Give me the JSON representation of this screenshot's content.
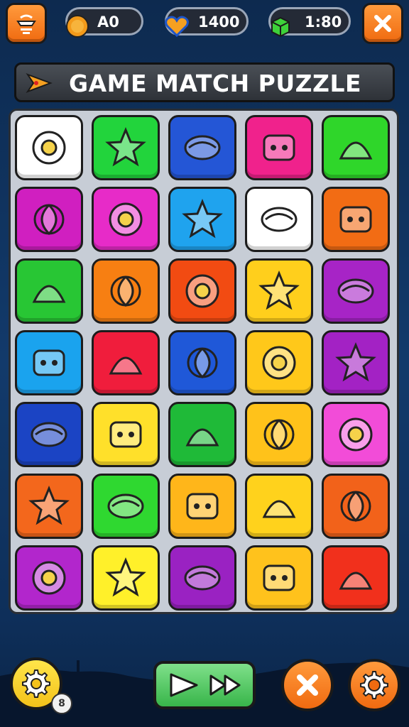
{
  "header": {
    "coins": {
      "value": "A0",
      "icon": "coin-icon"
    },
    "lives": {
      "value": "1400",
      "icon": "heart-icon"
    },
    "gems": {
      "value": "1:80",
      "icon": "cube-icon"
    }
  },
  "title": {
    "text": "GAME MATCH PUZZLE",
    "icon": "arrow-flag-icon"
  },
  "board": {
    "rows": 7,
    "cols": 5,
    "tiles": [
      {
        "icon": "flowers-icon",
        "color": "#ffffff"
      },
      {
        "icon": "star-face-icon",
        "color": "#22d43c"
      },
      {
        "icon": "leaf-swirl-icon",
        "color": "#2456d6"
      },
      {
        "icon": "fish-ball-icon",
        "color": "#f0228c"
      },
      {
        "icon": "spiral-icon",
        "color": "#2fd62a"
      },
      {
        "icon": "cloud-blob-icon",
        "color": "#d01fc0"
      },
      {
        "icon": "ring-fruit-icon",
        "color": "#e72bc8"
      },
      {
        "icon": "crayon-icon",
        "color": "#1fa3ee"
      },
      {
        "icon": "crossed-sticks-icon",
        "color": "#ffffff"
      },
      {
        "icon": "domino-icon",
        "color": "#f26c14"
      },
      {
        "icon": "swirl-bubble-icon",
        "color": "#28c634"
      },
      {
        "icon": "spiky-ball-icon",
        "color": "#f77f12"
      },
      {
        "icon": "bell-flower-icon",
        "color": "#f24b12"
      },
      {
        "icon": "red-sun-face-icon",
        "color": "#ffcf1c"
      },
      {
        "icon": "star-emoji-icon",
        "color": "#a724c6"
      },
      {
        "icon": "sunflower-icon",
        "color": "#1aa3ee"
      },
      {
        "icon": "blue-fruit-icon",
        "color": "#f01d3c"
      },
      {
        "icon": "pink-hook-icon",
        "color": "#1f58d8"
      },
      {
        "icon": "planet-ball-icon",
        "color": "#ffc81a"
      },
      {
        "icon": "pink-pretzel-icon",
        "color": "#a322c4"
      },
      {
        "icon": "red-leaf-icon",
        "color": "#1b44c4"
      },
      {
        "icon": "rainbow-swirl-icon",
        "color": "#ffe02a"
      },
      {
        "icon": "cookie-lollipop-icon",
        "color": "#1fba38"
      },
      {
        "icon": "paper-plane-icon",
        "color": "#ffc21a"
      },
      {
        "icon": "dice-face-icon",
        "color": "#f24cd8"
      },
      {
        "icon": "red-box-icon",
        "color": "#f3671c"
      },
      {
        "icon": "green-c-icon",
        "color": "#2fd830"
      },
      {
        "icon": "lipstick-icon",
        "color": "#ffb61a"
      },
      {
        "icon": "pink-whale-icon",
        "color": "#ffd21c"
      },
      {
        "icon": "green-bubbles-icon",
        "color": "#f2621a"
      },
      {
        "icon": "blue-bird-icon",
        "color": "#b226cc"
      },
      {
        "icon": "feather-pen-icon",
        "color": "#fff02a"
      },
      {
        "icon": "yellow-lemon-icon",
        "color": "#9a22c2"
      },
      {
        "icon": "carrot-icon",
        "color": "#ffc21c"
      },
      {
        "icon": "green-leaf-fork-icon",
        "color": "#f1301c"
      }
    ]
  },
  "footer": {
    "settings_badge": "8",
    "buttons": [
      "settings-gear-icon",
      "play-next-icon",
      "close-x-icon",
      "restart-icon"
    ]
  },
  "colors": {
    "accent": "#f47a1f",
    "play": "#38b54a",
    "title_bar": "#3a3e45",
    "board": "#c7cdd6"
  }
}
